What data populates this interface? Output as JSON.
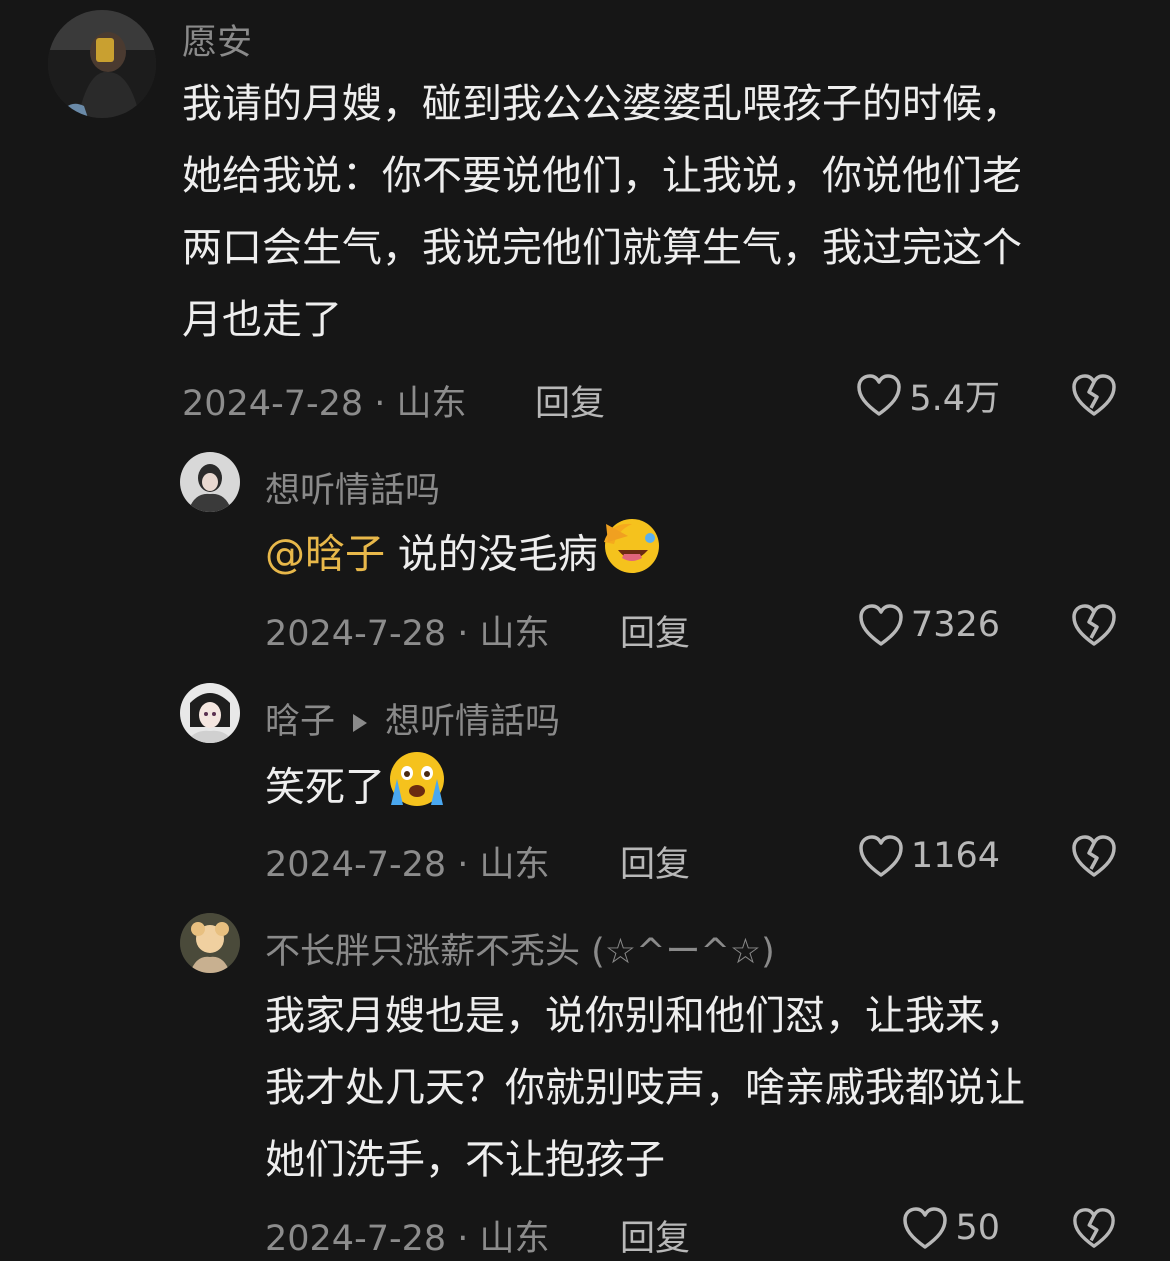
{
  "comments": [
    {
      "username": "愿安",
      "lines": [
        "我请的月嫂，碰到我公公婆婆乱喂孩子的时候，",
        "她给我说：你不要说他们，让我说，你说他们老",
        "两口会生气，我说完他们就算生气，我过完这个",
        "月也走了"
      ],
      "date_location": "2024-7-28 · 山东",
      "reply_label": "回复",
      "likes": "5.4万"
    },
    {
      "username": "想听情話吗",
      "mention": "@晗子",
      "text": "说的没毛病",
      "emoji": "facepalm-laugh-emoji",
      "date_location": "2024-7-28 · 山东",
      "reply_label": "回复",
      "likes": "7326"
    },
    {
      "username": "晗子",
      "reply_to": "想听情話吗",
      "text": "笑死了",
      "emoji": "crying-face-emoji",
      "date_location": "2024-7-28 · 山东",
      "reply_label": "回复",
      "likes": "1164"
    },
    {
      "username": "不长胖只涨薪不秃头 (☆^ー^☆)",
      "lines": [
        "我家月嫂也是，说你别和他们怼，让我来，",
        "我才处几天？你就别吱声，啥亲戚我都说让",
        "她们洗手，不让抱孩子"
      ],
      "date_location": "2024-7-28 · 山东",
      "reply_label": "回复",
      "likes": "50"
    }
  ],
  "colors": {
    "background": "#161616",
    "username": "#8a8a8a",
    "text": "#eeeeee",
    "mention": "#e8b84a",
    "meta": "#8c8c8c"
  },
  "icons": {
    "like": "heart-outline-icon",
    "dislike": "broken-heart-icon",
    "reply_arrow": "triangle-right-icon"
  }
}
